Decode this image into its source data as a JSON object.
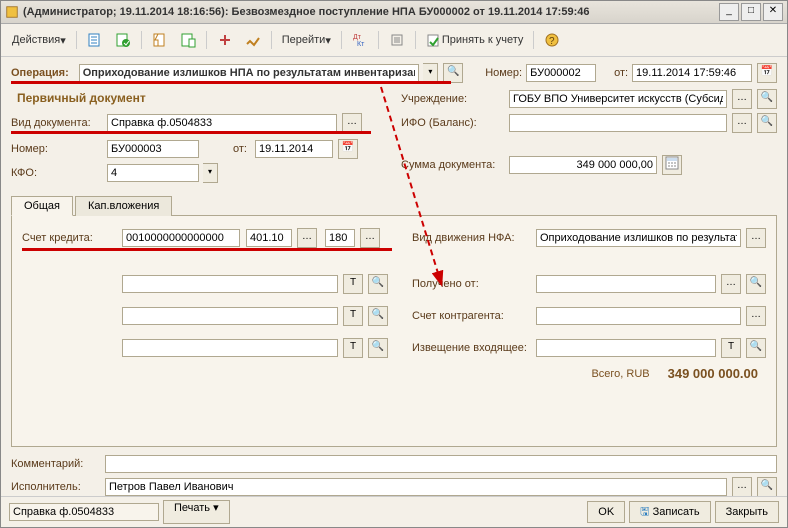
{
  "window": {
    "title": "(Администратор; 19.11.2014 18:16:56): Безвозмездное поступление НПА БУ000002 от 19.11.2014 17:59:46"
  },
  "toolbar": {
    "actions": "Действия",
    "goto": "Перейти",
    "accept": "Принять к учету"
  },
  "op": {
    "label": "Операция:",
    "value": "Оприходование излишков НПА по результатам инвентаризации",
    "numLabel": "Номер:",
    "num": "БУ000002",
    "fromLabel": "от:",
    "date": "19.11.2014 17:59:46"
  },
  "primary": {
    "header": "Первичный документ"
  },
  "left": {
    "docTypeLabel": "Вид документа:",
    "docType": "Справка ф.0504833",
    "numLabel": "Номер:",
    "num": "БУ000003",
    "fromLabel": "от:",
    "date": "19.11.2014",
    "kfoLabel": "КФО:",
    "kfo": "4"
  },
  "right": {
    "orgLabel": "Учреждение:",
    "org": "ГОБУ ВПО Университет искусств (Субсидия)",
    "ifoLabel": "ИФО (Баланс):",
    "ifo": "",
    "sumLabel": "Сумма документа:",
    "sum": "349 000 000,00"
  },
  "tabs": {
    "general": "Общая",
    "capital": "Кап.вложения"
  },
  "credit": {
    "label": "Счет кредита:",
    "acc1": "0010000000000000",
    "acc2": "401.10",
    "acc3": "180",
    "nfaLabel": "Вид движения НФА:",
    "nfa": "Оприходование излишков по результатам",
    "recvLabel": "Получено от:",
    "recv": "",
    "counterLabel": "Счет контрагента:",
    "counter": "",
    "noticeLabel": "Извещение входящее:",
    "notice": ""
  },
  "total": {
    "label": "Всего, RUB",
    "value": "349 000 000.00"
  },
  "bottom": {
    "commentLabel": "Комментарий:",
    "comment": "",
    "execLabel": "Исполнитель:",
    "exec": "Петров Павел Иванович"
  },
  "footer": {
    "doc": "Справка ф.0504833",
    "print": "Печать",
    "ok": "OK",
    "save": "Записать",
    "close": "Закрыть"
  }
}
